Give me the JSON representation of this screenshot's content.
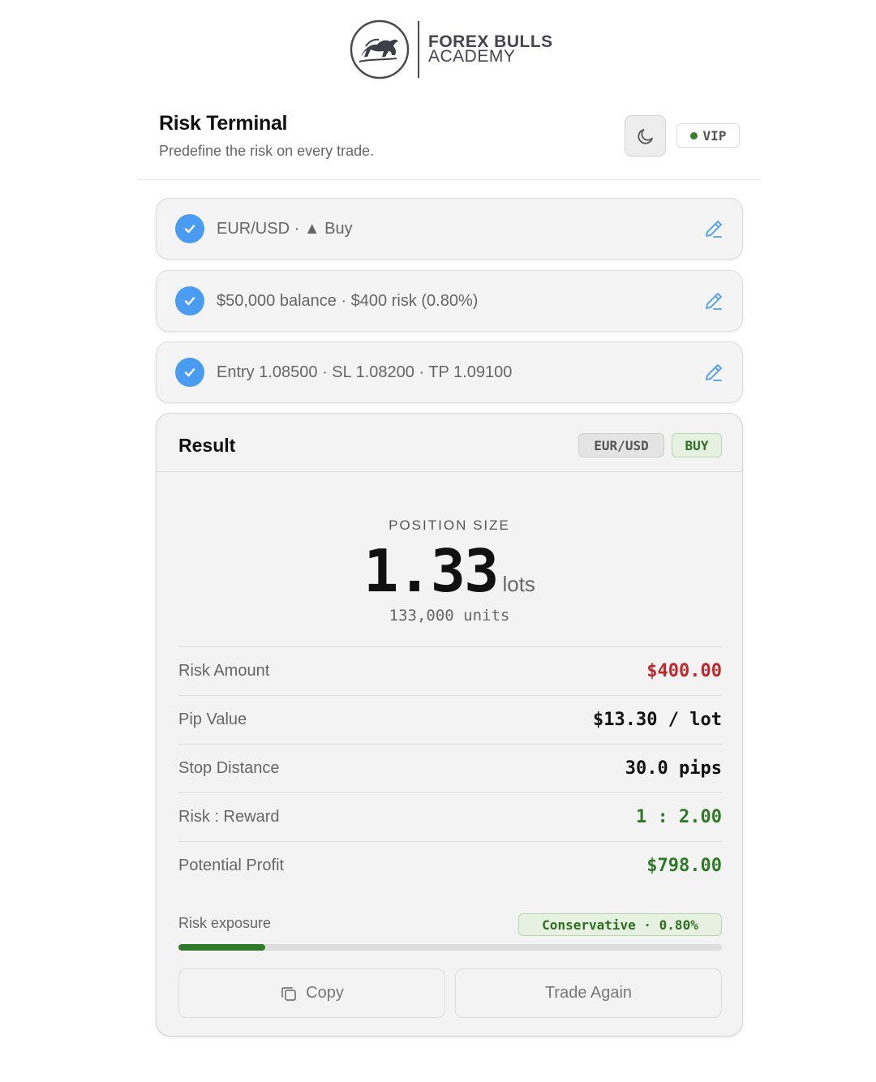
{
  "brand": {
    "line1": "FOREX BULLS",
    "line2": "ACADEMY"
  },
  "header": {
    "title": "Risk Terminal",
    "subtitle": "Predefine the risk on every trade.",
    "theme_icon": "moon-icon",
    "vip_label": "VIP",
    "vip_dot_color": "#3a7d2c"
  },
  "steps": [
    {
      "text": "EUR/USD · ▲ Buy",
      "icon": "check-icon",
      "edit_icon": "pencil-icon"
    },
    {
      "text": "$50,000 balance · $400 risk (0.80%)",
      "icon": "check-icon",
      "edit_icon": "pencil-icon"
    },
    {
      "text": "Entry 1.08500 · SL 1.08200 · TP 1.09100",
      "icon": "check-icon",
      "edit_icon": "pencil-icon"
    }
  ],
  "result": {
    "title": "Result",
    "pair_tag": "EUR/USD",
    "side_tag": "BUY",
    "position_label": "POSITION SIZE",
    "position_value": "1.33",
    "position_unit": "lots",
    "units": "133,000 units",
    "rows": [
      {
        "label": "Risk Amount",
        "value": "$400.00",
        "color": "#c0282d"
      },
      {
        "label": "Pip Value",
        "value": "$13.30 / lot",
        "color": "#111111"
      },
      {
        "label": "Stop Distance",
        "value": "30.0 pips",
        "color": "#111111"
      },
      {
        "label": "Risk : Reward",
        "value": "1 : 2.00",
        "color": "#2f7a28"
      },
      {
        "label": "Potential Profit",
        "value": "$798.00",
        "color": "#2f7a28"
      }
    ],
    "exposure": {
      "label": "Risk exposure",
      "badge": "Conservative · 0.80%",
      "level_fraction": 0.16
    },
    "buttons": {
      "copy_label": "Copy",
      "copy_icon": "copy-icon",
      "again_label": "Trade Again"
    }
  },
  "colors": {
    "accent_blue": "#4a9cf0",
    "success_green": "#2f7a28",
    "danger_red": "#c0282d"
  }
}
